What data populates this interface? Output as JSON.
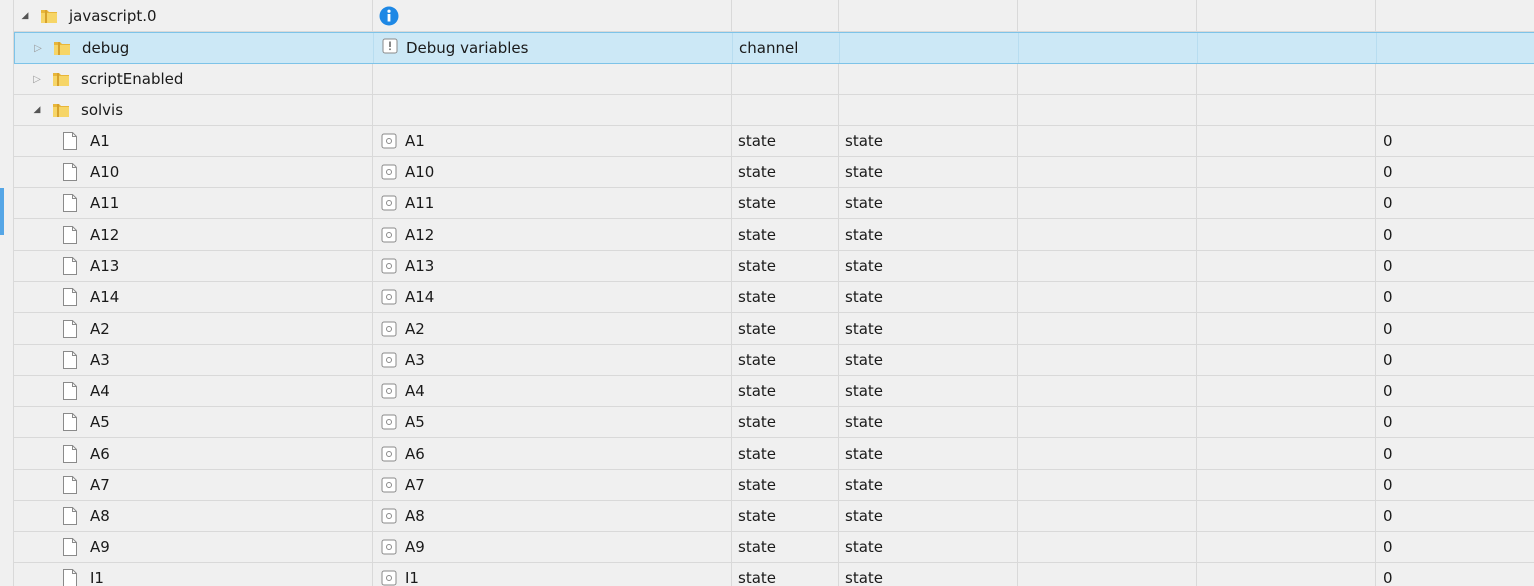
{
  "tree": {
    "rows": [
      {
        "kind": "root",
        "expander": "expanded",
        "icon": "folder-icon",
        "name": "javascript.0",
        "col1_icon": "info-icon",
        "col1": "",
        "col2": "",
        "col3": "",
        "col6": ""
      },
      {
        "kind": "folder",
        "expander": "collapsed",
        "icon": "folder-icon",
        "name": "debug",
        "col1_icon": "channel-icon",
        "col1": "Debug variables",
        "col2": "channel",
        "col3": "",
        "col6": "",
        "selected": true
      },
      {
        "kind": "folder",
        "expander": "collapsed",
        "icon": "folder-icon",
        "name": "scriptEnabled",
        "col1_icon": "",
        "col1": "",
        "col2": "",
        "col3": "",
        "col6": ""
      },
      {
        "kind": "folder",
        "expander": "expanded",
        "icon": "folder-icon",
        "name": "solvis",
        "col1_icon": "",
        "col1": "",
        "col2": "",
        "col3": "",
        "col6": ""
      },
      {
        "kind": "state",
        "icon": "file-icon",
        "name": "A1",
        "col1_icon": "state-icon",
        "col1": "A1",
        "col2": "state",
        "col3": "state",
        "col6": "0"
      },
      {
        "kind": "state",
        "icon": "file-icon",
        "name": "A10",
        "col1_icon": "state-icon",
        "col1": "A10",
        "col2": "state",
        "col3": "state",
        "col6": "0"
      },
      {
        "kind": "state",
        "icon": "file-icon",
        "name": "A11",
        "col1_icon": "state-icon",
        "col1": "A11",
        "col2": "state",
        "col3": "state",
        "col6": "0"
      },
      {
        "kind": "state",
        "icon": "file-icon",
        "name": "A12",
        "col1_icon": "state-icon",
        "col1": "A12",
        "col2": "state",
        "col3": "state",
        "col6": "0"
      },
      {
        "kind": "state",
        "icon": "file-icon",
        "name": "A13",
        "col1_icon": "state-icon",
        "col1": "A13",
        "col2": "state",
        "col3": "state",
        "col6": "0"
      },
      {
        "kind": "state",
        "icon": "file-icon",
        "name": "A14",
        "col1_icon": "state-icon",
        "col1": "A14",
        "col2": "state",
        "col3": "state",
        "col6": "0"
      },
      {
        "kind": "state",
        "icon": "file-icon",
        "name": "A2",
        "col1_icon": "state-icon",
        "col1": "A2",
        "col2": "state",
        "col3": "state",
        "col6": "0"
      },
      {
        "kind": "state",
        "icon": "file-icon",
        "name": "A3",
        "col1_icon": "state-icon",
        "col1": "A3",
        "col2": "state",
        "col3": "state",
        "col6": "0"
      },
      {
        "kind": "state",
        "icon": "file-icon",
        "name": "A4",
        "col1_icon": "state-icon",
        "col1": "A4",
        "col2": "state",
        "col3": "state",
        "col6": "0"
      },
      {
        "kind": "state",
        "icon": "file-icon",
        "name": "A5",
        "col1_icon": "state-icon",
        "col1": "A5",
        "col2": "state",
        "col3": "state",
        "col6": "0"
      },
      {
        "kind": "state",
        "icon": "file-icon",
        "name": "A6",
        "col1_icon": "state-icon",
        "col1": "A6",
        "col2": "state",
        "col3": "state",
        "col6": "0"
      },
      {
        "kind": "state",
        "icon": "file-icon",
        "name": "A7",
        "col1_icon": "state-icon",
        "col1": "A7",
        "col2": "state",
        "col3": "state",
        "col6": "0"
      },
      {
        "kind": "state",
        "icon": "file-icon",
        "name": "A8",
        "col1_icon": "state-icon",
        "col1": "A8",
        "col2": "state",
        "col3": "state",
        "col6": "0"
      },
      {
        "kind": "state",
        "icon": "file-icon",
        "name": "A9",
        "col1_icon": "state-icon",
        "col1": "A9",
        "col2": "state",
        "col3": "state",
        "col6": "0"
      },
      {
        "kind": "state",
        "icon": "file-icon",
        "name": "I1",
        "col1_icon": "state-icon",
        "col1": "I1",
        "col2": "state",
        "col3": "state",
        "col6": "0"
      }
    ]
  },
  "colors": {
    "selected_row": "#cce8f6",
    "selected_border": "#7dc3e8",
    "info_blue": "#1e88e5",
    "folder_yellow": "#f2c744"
  }
}
